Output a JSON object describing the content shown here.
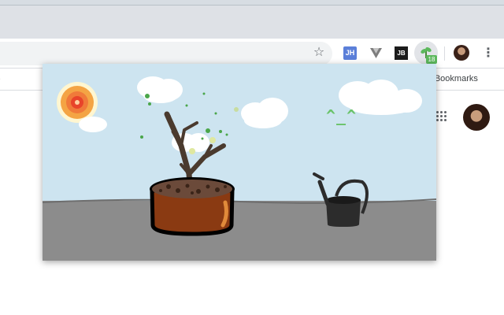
{
  "browser": {
    "bookmarks_bar": {
      "other_bookmarks_label": "er Bookmarks",
      "partial_left_label": "."
    },
    "toolbar": {
      "star_glyph": "☆",
      "extensions": [
        {
          "name": "JH",
          "label": "JH"
        },
        {
          "name": "vue-devtools",
          "label": ""
        },
        {
          "name": "JB",
          "label": "JB"
        },
        {
          "name": "plant",
          "label": "",
          "badge": "18"
        }
      ],
      "menu_glyph": "⋮"
    }
  },
  "popup": {
    "face_text": "^_^",
    "colors": {
      "sky": "#cde4f0",
      "ground": "#8c8c8c",
      "pot": "#8a3a12",
      "sun_core": "#e8442a",
      "sun_ring": "#f4a444",
      "face": "#6ac36a",
      "can": "#2c2c2c"
    },
    "icons": [
      "sun-icon",
      "cloud-icon",
      "plant-icon",
      "pot-icon",
      "watering-can-icon"
    ]
  }
}
